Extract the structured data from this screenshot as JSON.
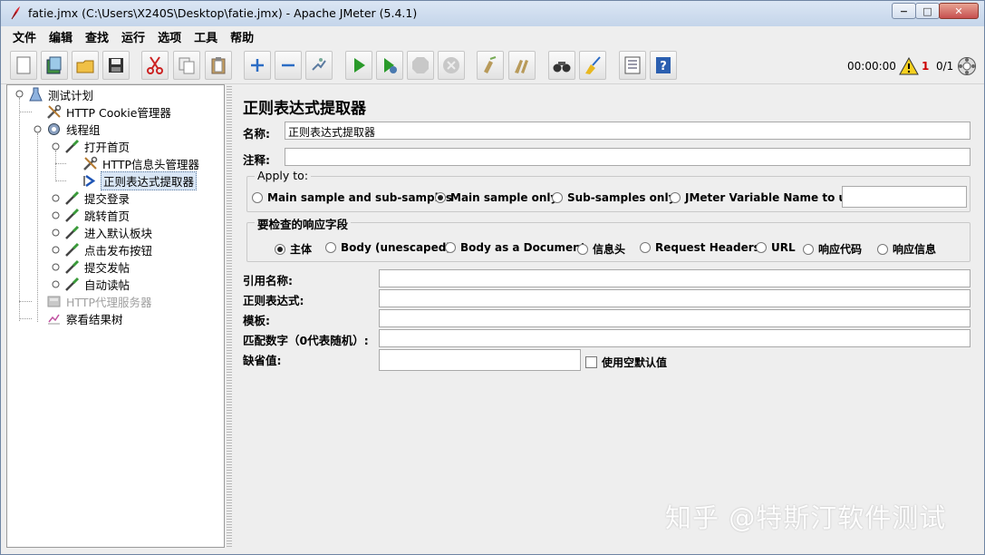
{
  "window": {
    "title": "fatie.jmx (C:\\Users\\X240S\\Desktop\\fatie.jmx) - Apache JMeter (5.4.1)",
    "min_glyph": "−",
    "max_glyph": "□",
    "close_glyph": "✕"
  },
  "menu": [
    "文件",
    "编辑",
    "查找",
    "运行",
    "选项",
    "工具",
    "帮助"
  ],
  "toolbar": {
    "buttons": [
      "new-icon",
      "templates-icon",
      "open-icon",
      "save-icon",
      "cut-icon",
      "copy-icon",
      "paste-icon",
      "expand-icon",
      "collapse-icon",
      "toggle-icon",
      "start-icon",
      "start-no-pause-icon",
      "stop-icon",
      "shutdown-icon",
      "clear-icon",
      "clear-all-icon",
      "search-icon",
      "reset-search-icon",
      "function-helper-icon",
      "help-icon"
    ],
    "timer": "00:00:00",
    "warning_count": "1",
    "threads": "0/1"
  },
  "tree": [
    {
      "label": "测试计划",
      "icon": "test-plan-icon"
    },
    {
      "label": "HTTP Cookie管理器",
      "icon": "config-wrench-icon"
    },
    {
      "label": "线程组",
      "icon": "thread-group-gear-icon"
    },
    {
      "label": "打开首页",
      "icon": "sampler-pipette-icon"
    },
    {
      "label": "HTTP信息头管理器",
      "icon": "config-wrench-icon"
    },
    {
      "label": "正则表达式提取器",
      "icon": "post-processor-arrow-icon"
    },
    {
      "label": "提交登录",
      "icon": "sampler-pipette-icon"
    },
    {
      "label": "跳转首页",
      "icon": "sampler-pipette-icon"
    },
    {
      "label": "进入默认板块",
      "icon": "sampler-pipette-icon"
    },
    {
      "label": "点击发布按钮",
      "icon": "sampler-pipette-icon"
    },
    {
      "label": "提交发帖",
      "icon": "sampler-pipette-icon"
    },
    {
      "label": "自动读帖",
      "icon": "sampler-pipette-icon"
    },
    {
      "label": "HTTP代理服务器",
      "icon": "proxy-server-icon"
    },
    {
      "label": "察看结果树",
      "icon": "listener-graph-icon"
    }
  ],
  "panel": {
    "title": "正则表达式提取器",
    "name_label": "名称:",
    "name_value": "正则表达式提取器",
    "comment_label": "注释:",
    "comment_value": "",
    "apply_to": {
      "title": "Apply to:",
      "options": [
        "Main sample and sub-samples",
        "Main sample only",
        "Sub-samples only",
        "JMeter Variable Name to use"
      ],
      "selected": "Main sample only",
      "variable_value": ""
    },
    "field_to_check": {
      "title": "要检查的响应字段",
      "options": [
        "主体",
        "Body (unescaped)",
        "Body as a Document",
        "信息头",
        "Request Headers",
        "URL",
        "响应代码",
        "响应信息"
      ],
      "selected": "主体"
    },
    "ref_name_label": "引用名称:",
    "ref_name_value": "",
    "regex_label": "正则表达式:",
    "regex_value": "",
    "template_label": "模板:",
    "template_value": "",
    "match_no_label": "匹配数字（0代表随机）:",
    "match_no_value": "",
    "default_label": "缺省值:",
    "default_value": "",
    "use_empty_default_label": "使用空默认值"
  },
  "watermark": "知乎 @特斯汀软件测试"
}
